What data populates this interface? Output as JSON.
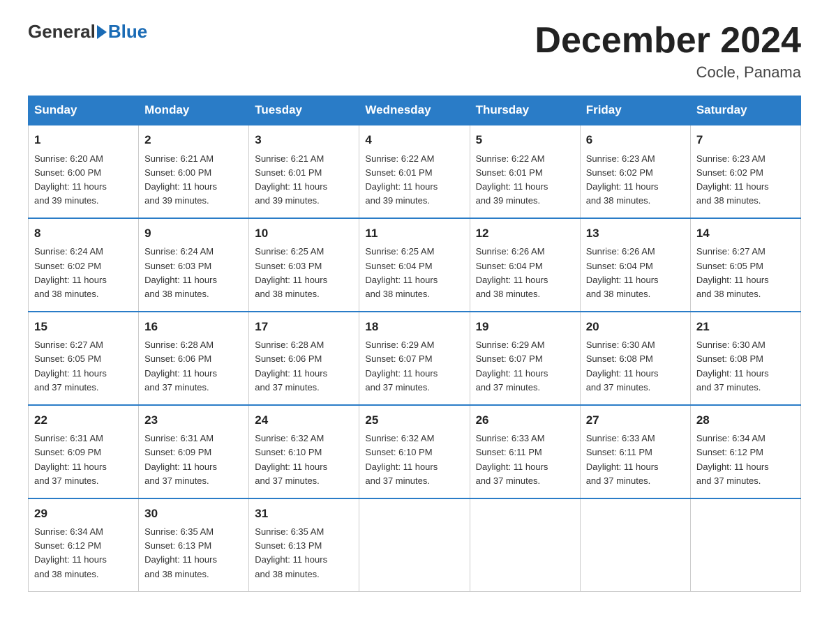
{
  "header": {
    "logo_general": "General",
    "logo_blue": "Blue",
    "title": "December 2024",
    "location": "Cocle, Panama"
  },
  "weekdays": [
    "Sunday",
    "Monday",
    "Tuesday",
    "Wednesday",
    "Thursday",
    "Friday",
    "Saturday"
  ],
  "weeks": [
    [
      {
        "day": "1",
        "sunrise": "6:20 AM",
        "sunset": "6:00 PM",
        "daylight": "11 hours and 39 minutes."
      },
      {
        "day": "2",
        "sunrise": "6:21 AM",
        "sunset": "6:00 PM",
        "daylight": "11 hours and 39 minutes."
      },
      {
        "day": "3",
        "sunrise": "6:21 AM",
        "sunset": "6:01 PM",
        "daylight": "11 hours and 39 minutes."
      },
      {
        "day": "4",
        "sunrise": "6:22 AM",
        "sunset": "6:01 PM",
        "daylight": "11 hours and 39 minutes."
      },
      {
        "day": "5",
        "sunrise": "6:22 AM",
        "sunset": "6:01 PM",
        "daylight": "11 hours and 39 minutes."
      },
      {
        "day": "6",
        "sunrise": "6:23 AM",
        "sunset": "6:02 PM",
        "daylight": "11 hours and 38 minutes."
      },
      {
        "day": "7",
        "sunrise": "6:23 AM",
        "sunset": "6:02 PM",
        "daylight": "11 hours and 38 minutes."
      }
    ],
    [
      {
        "day": "8",
        "sunrise": "6:24 AM",
        "sunset": "6:02 PM",
        "daylight": "11 hours and 38 minutes."
      },
      {
        "day": "9",
        "sunrise": "6:24 AM",
        "sunset": "6:03 PM",
        "daylight": "11 hours and 38 minutes."
      },
      {
        "day": "10",
        "sunrise": "6:25 AM",
        "sunset": "6:03 PM",
        "daylight": "11 hours and 38 minutes."
      },
      {
        "day": "11",
        "sunrise": "6:25 AM",
        "sunset": "6:04 PM",
        "daylight": "11 hours and 38 minutes."
      },
      {
        "day": "12",
        "sunrise": "6:26 AM",
        "sunset": "6:04 PM",
        "daylight": "11 hours and 38 minutes."
      },
      {
        "day": "13",
        "sunrise": "6:26 AM",
        "sunset": "6:04 PM",
        "daylight": "11 hours and 38 minutes."
      },
      {
        "day": "14",
        "sunrise": "6:27 AM",
        "sunset": "6:05 PM",
        "daylight": "11 hours and 38 minutes."
      }
    ],
    [
      {
        "day": "15",
        "sunrise": "6:27 AM",
        "sunset": "6:05 PM",
        "daylight": "11 hours and 37 minutes."
      },
      {
        "day": "16",
        "sunrise": "6:28 AM",
        "sunset": "6:06 PM",
        "daylight": "11 hours and 37 minutes."
      },
      {
        "day": "17",
        "sunrise": "6:28 AM",
        "sunset": "6:06 PM",
        "daylight": "11 hours and 37 minutes."
      },
      {
        "day": "18",
        "sunrise": "6:29 AM",
        "sunset": "6:07 PM",
        "daylight": "11 hours and 37 minutes."
      },
      {
        "day": "19",
        "sunrise": "6:29 AM",
        "sunset": "6:07 PM",
        "daylight": "11 hours and 37 minutes."
      },
      {
        "day": "20",
        "sunrise": "6:30 AM",
        "sunset": "6:08 PM",
        "daylight": "11 hours and 37 minutes."
      },
      {
        "day": "21",
        "sunrise": "6:30 AM",
        "sunset": "6:08 PM",
        "daylight": "11 hours and 37 minutes."
      }
    ],
    [
      {
        "day": "22",
        "sunrise": "6:31 AM",
        "sunset": "6:09 PM",
        "daylight": "11 hours and 37 minutes."
      },
      {
        "day": "23",
        "sunrise": "6:31 AM",
        "sunset": "6:09 PM",
        "daylight": "11 hours and 37 minutes."
      },
      {
        "day": "24",
        "sunrise": "6:32 AM",
        "sunset": "6:10 PM",
        "daylight": "11 hours and 37 minutes."
      },
      {
        "day": "25",
        "sunrise": "6:32 AM",
        "sunset": "6:10 PM",
        "daylight": "11 hours and 37 minutes."
      },
      {
        "day": "26",
        "sunrise": "6:33 AM",
        "sunset": "6:11 PM",
        "daylight": "11 hours and 37 minutes."
      },
      {
        "day": "27",
        "sunrise": "6:33 AM",
        "sunset": "6:11 PM",
        "daylight": "11 hours and 37 minutes."
      },
      {
        "day": "28",
        "sunrise": "6:34 AM",
        "sunset": "6:12 PM",
        "daylight": "11 hours and 37 minutes."
      }
    ],
    [
      {
        "day": "29",
        "sunrise": "6:34 AM",
        "sunset": "6:12 PM",
        "daylight": "11 hours and 38 minutes."
      },
      {
        "day": "30",
        "sunrise": "6:35 AM",
        "sunset": "6:13 PM",
        "daylight": "11 hours and 38 minutes."
      },
      {
        "day": "31",
        "sunrise": "6:35 AM",
        "sunset": "6:13 PM",
        "daylight": "11 hours and 38 minutes."
      },
      null,
      null,
      null,
      null
    ]
  ],
  "labels": {
    "sunrise": "Sunrise:",
    "sunset": "Sunset:",
    "daylight": "Daylight:"
  }
}
